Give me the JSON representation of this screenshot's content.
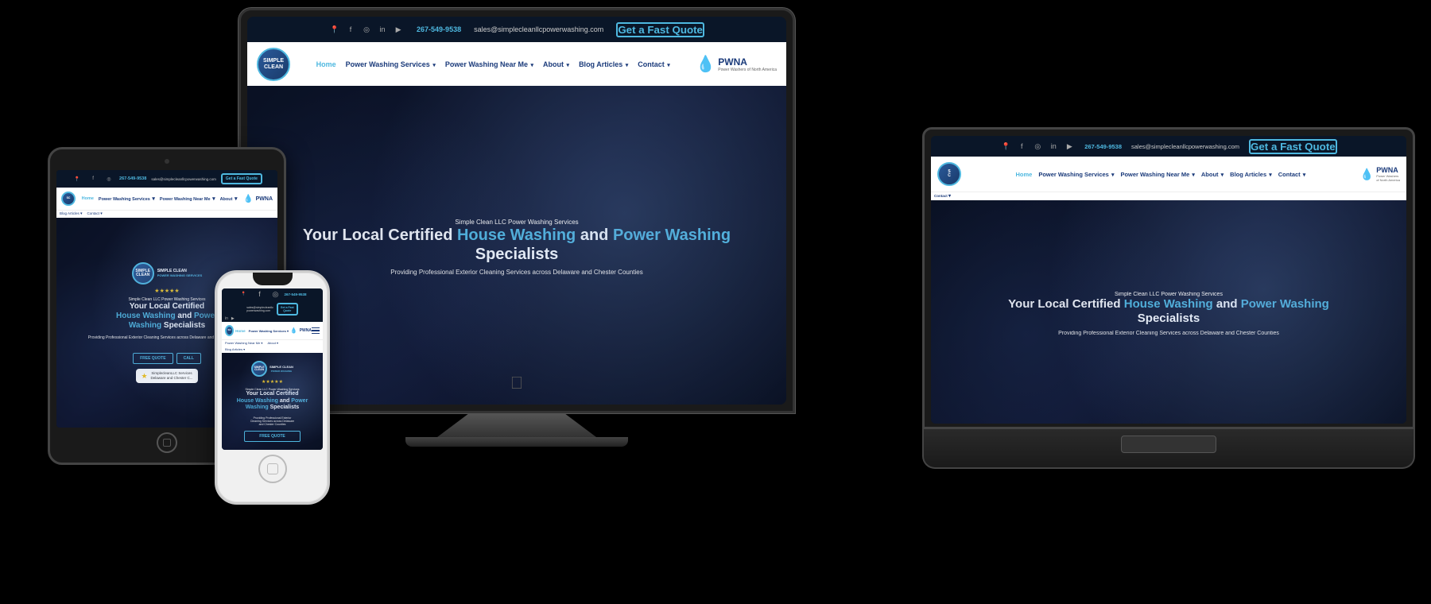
{
  "site": {
    "topbar": {
      "phone": "267-549-9538",
      "email": "sales@simplecleanllcpowerwashing.com",
      "cta_label": "Get a Fast Quote"
    },
    "nav": {
      "logo_text": "SIMPLE\nCLEAN",
      "logo_sub": "POWER WASHING SERVICES",
      "links": [
        {
          "label": "Home",
          "active": true,
          "has_dropdown": false
        },
        {
          "label": "Power Washing Services",
          "active": false,
          "has_dropdown": true
        },
        {
          "label": "Power Washing Near Me",
          "active": false,
          "has_dropdown": true
        },
        {
          "label": "About",
          "active": false,
          "has_dropdown": true
        },
        {
          "label": "Blog Articles",
          "active": false,
          "has_dropdown": true
        },
        {
          "label": "Contact",
          "active": false,
          "has_dropdown": true
        }
      ],
      "pwna_label": "PWNA",
      "pwna_sub": "Power Washers of North America"
    },
    "hero": {
      "subtitle": "Simple Clean LLC Power Washing Services",
      "title_plain": "Your Local Certified ",
      "title_highlight1": "House Washing",
      "title_and": " and ",
      "title_highlight2": "Power Washing",
      "title_specialists": " Specialists",
      "description": "Providing Professional Exterior Cleaning Services across Delaware and Chester Counties",
      "cta_label": "FREE QUOTE",
      "cta2_label": "CALL"
    },
    "review": {
      "stars": "★★★★★",
      "text_line1": "SimplecleanLLC Services",
      "text_line2": "Delaware and Chester C...",
      "star_label": "★"
    }
  },
  "devices": {
    "monitor_apple_symbol": "",
    "phone_call_icon": "📞"
  }
}
